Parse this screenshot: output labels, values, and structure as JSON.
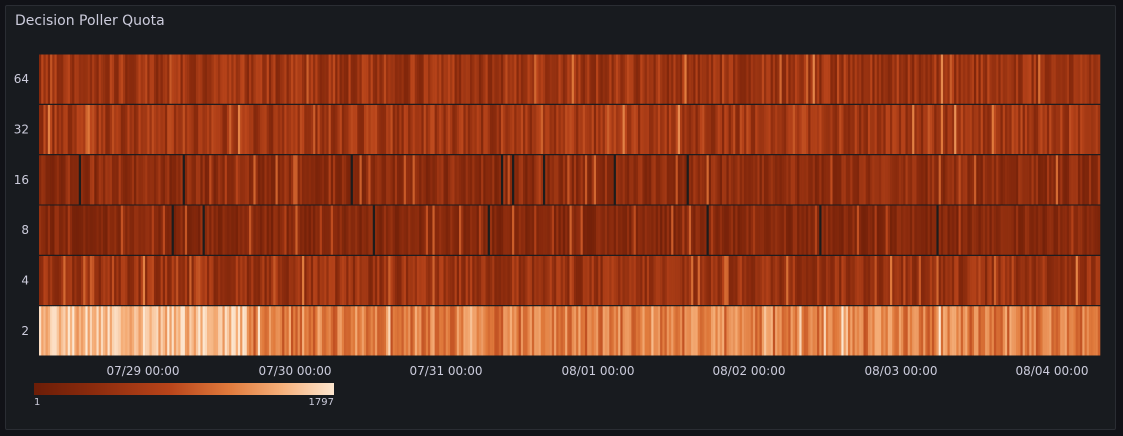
{
  "panel": {
    "title": "Decision Poller Quota"
  },
  "chart_data": {
    "type": "heatmap",
    "title": "Decision Poller Quota",
    "y_buckets": [
      "64",
      "32",
      "16",
      "8",
      "4",
      "2"
    ],
    "x_tick_labels": [
      "07/29 00:00",
      "07/30 00:00",
      "07/31 00:00",
      "08/01 00:00",
      "08/02 00:00",
      "08/03 00:00",
      "08/04 00:00"
    ],
    "x_range": [
      "07/28 10:00",
      "08/04 08:00"
    ],
    "color_scale": {
      "min": 1,
      "max": 1797,
      "colors": [
        "#6b1d07",
        "#8b2b0d",
        "#b8441a",
        "#e07a3c",
        "#f5ae78",
        "#fde6cf"
      ],
      "empty_color": "#1c1c1c"
    },
    "row_intensity": [
      {
        "bucket": "64",
        "mean": 0.28,
        "spread": 0.14
      },
      {
        "bucket": "32",
        "mean": 0.3,
        "spread": 0.14
      },
      {
        "bucket": "16",
        "mean": 0.2,
        "spread": 0.12
      },
      {
        "bucket": "8",
        "mean": 0.16,
        "spread": 0.1
      },
      {
        "bucket": "4",
        "mean": 0.26,
        "spread": 0.13
      },
      {
        "bucket": "2",
        "mean": 0.62,
        "spread": 0.18
      }
    ],
    "legend": {
      "min_label": "1",
      "max_label": "1797"
    }
  }
}
